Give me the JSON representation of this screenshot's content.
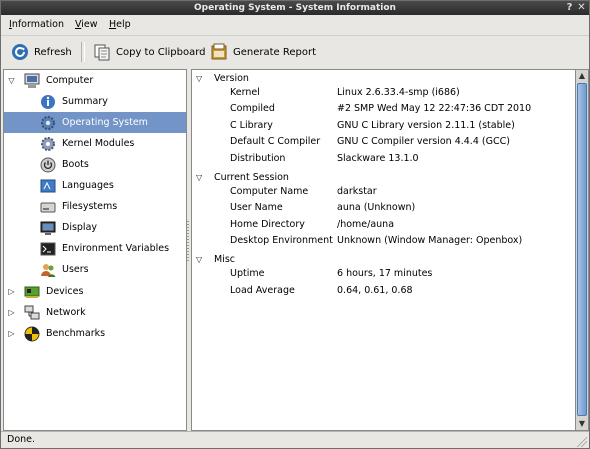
{
  "window": {
    "title": "Operating System - System Information",
    "buttons": [
      "?",
      "✕"
    ]
  },
  "menu": [
    {
      "label": "Information",
      "mnemonic": "I"
    },
    {
      "label": "View",
      "mnemonic": "V"
    },
    {
      "label": "Help",
      "mnemonic": "H"
    }
  ],
  "toolbar": {
    "refresh": "Refresh",
    "copy": "Copy to Clipboard",
    "report": "Generate Report"
  },
  "tree": [
    {
      "label": "Computer",
      "icon": "computer-icon",
      "expanded": true,
      "level": 0
    },
    {
      "label": "Summary",
      "icon": "info-icon",
      "level": 1
    },
    {
      "label": "Operating System",
      "icon": "os-gear-icon",
      "level": 1,
      "selected": true
    },
    {
      "label": "Kernel Modules",
      "icon": "kernel-modules-icon",
      "level": 1
    },
    {
      "label": "Boots",
      "icon": "power-icon",
      "level": 1
    },
    {
      "label": "Languages",
      "icon": "languages-icon",
      "level": 1
    },
    {
      "label": "Filesystems",
      "icon": "filesystem-icon",
      "level": 1
    },
    {
      "label": "Display",
      "icon": "display-icon",
      "level": 1
    },
    {
      "label": "Environment Variables",
      "icon": "terminal-icon",
      "level": 1
    },
    {
      "label": "Users",
      "icon": "users-icon",
      "level": 1
    },
    {
      "label": "Devices",
      "icon": "devices-icon",
      "expanded": false,
      "level": 0
    },
    {
      "label": "Network",
      "icon": "network-icon",
      "expanded": false,
      "level": 0
    },
    {
      "label": "Benchmarks",
      "icon": "benchmarks-icon",
      "expanded": false,
      "level": 0
    }
  ],
  "details": {
    "version": {
      "title": "Version",
      "rows": [
        {
          "key": "Kernel",
          "value": "Linux 2.6.33.4-smp (i686)"
        },
        {
          "key": "Compiled",
          "value": "#2 SMP Wed May 12 22:47:36 CDT 2010"
        },
        {
          "key": "C Library",
          "value": "GNU C Library version 2.11.1 (stable)"
        },
        {
          "key": "Default C Compiler",
          "value": "GNU C Compiler version 4.4.4 (GCC)"
        },
        {
          "key": "Distribution",
          "value": "Slackware 13.1.0"
        }
      ]
    },
    "session": {
      "title": "Current Session",
      "rows": [
        {
          "key": "Computer Name",
          "value": "darkstar"
        },
        {
          "key": "User Name",
          "value": "auna (Unknown)"
        },
        {
          "key": "Home Directory",
          "value": "/home/auna"
        },
        {
          "key": "Desktop Environment",
          "value": "Unknown (Window Manager: Openbox)"
        }
      ]
    },
    "misc": {
      "title": "Misc",
      "rows": [
        {
          "key": "Uptime",
          "value": "6 hours, 17 minutes"
        },
        {
          "key": "Load Average",
          "value": "0.64, 0.61, 0.68"
        }
      ]
    }
  },
  "status": "Done.",
  "colors": {
    "selection": "#7394c6",
    "titlebar": "#2a2a2a",
    "scroll_thumb": "#6f9bd1"
  }
}
